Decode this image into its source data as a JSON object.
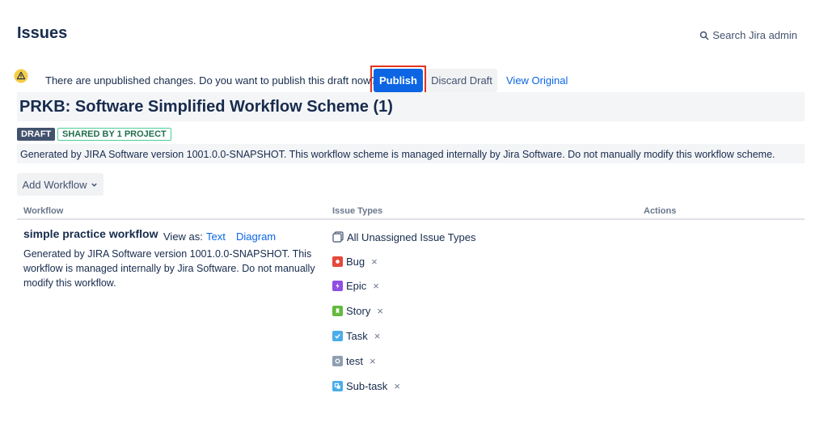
{
  "header": {
    "title": "Issues",
    "search_label": "Search Jira admin"
  },
  "draft_notice": {
    "message": "There are unpublished changes. Do you want to publish this draft now?",
    "publish_label": "Publish",
    "discard_label": "Discard Draft",
    "view_original_label": "View Original"
  },
  "scheme": {
    "title": "PRKB: Software Simplified Workflow Scheme (1)",
    "draft_lozenge": "DRAFT",
    "shared_lozenge": "SHARED BY 1 PROJECT",
    "description": "Generated by JIRA Software version 1001.0.0-SNAPSHOT. This workflow scheme is managed internally by Jira Software. Do not manually modify this workflow scheme."
  },
  "toolbar": {
    "add_workflow_label": "Add Workflow"
  },
  "table": {
    "columns": [
      "Workflow",
      "Issue Types",
      "Actions"
    ],
    "workflow": {
      "name": "simple practice workflow",
      "view_as_label": "View as:",
      "text_link": "Text",
      "diagram_link": "Diagram",
      "description": "Generated by JIRA Software version 1001.0.0-SNAPSHOT. This workflow is managed internally by Jira Software. Do not manually modify this workflow."
    },
    "issue_types": [
      {
        "label": "All Unassigned Issue Types",
        "icon": "unassigned-icon",
        "removable": false
      },
      {
        "label": "Bug",
        "icon": "bug-icon",
        "color": "#e5493a",
        "removable": true
      },
      {
        "label": "Epic",
        "icon": "epic-icon",
        "color": "#904ee2",
        "removable": true
      },
      {
        "label": "Story",
        "icon": "story-icon",
        "color": "#63ba3c",
        "removable": true
      },
      {
        "label": "Task",
        "icon": "task-icon",
        "color": "#4bade8",
        "removable": true
      },
      {
        "label": "test",
        "icon": "test-icon",
        "color": "#8f9fb2",
        "removable": true
      },
      {
        "label": "Sub-task",
        "icon": "subtask-icon",
        "color": "#4bade8",
        "removable": true
      }
    ],
    "remove_glyph": "×"
  },
  "colors": {
    "accent": "#0c66e4",
    "highlight_frame": "#e5331c"
  }
}
